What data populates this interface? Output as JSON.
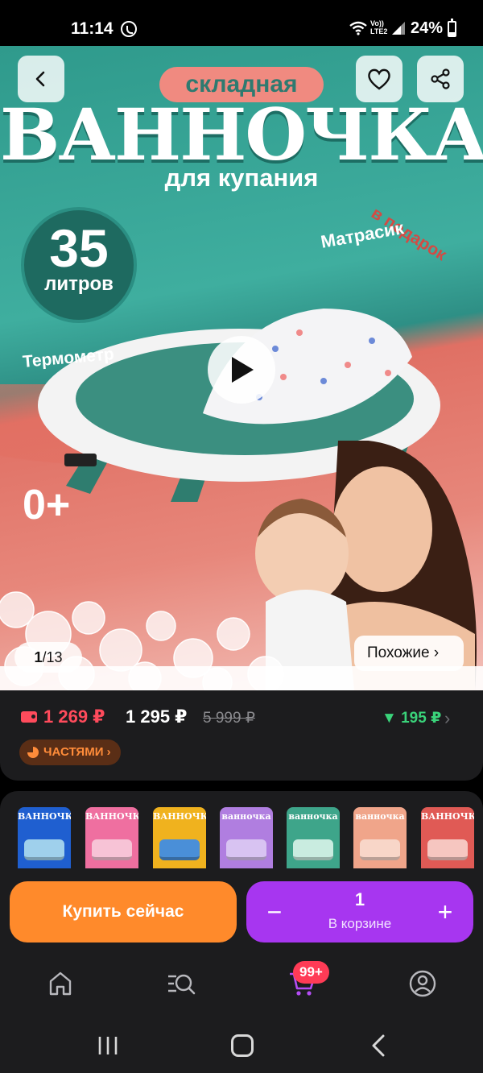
{
  "status_bar": {
    "time": "11:14",
    "network_label": "Vo)) LTE2",
    "battery": "24%"
  },
  "hero": {
    "pill_text": "складная",
    "title": "ВАННОЧКА",
    "subtitle": "для купания",
    "liters_number": "35",
    "liters_unit": "литров",
    "gift_label": "в подарок",
    "mattress_label": "Матрасик",
    "thermometer_label": "Термометр",
    "age_label": "0+",
    "counter_current": "1",
    "counter_total": "/13",
    "similar_label": "Похожие ›",
    "colors": {
      "teal": "#2f9a8c",
      "coral": "#e07064"
    }
  },
  "price": {
    "card_price": "1 269 ₽",
    "price": "1 295 ₽",
    "old_price": "5 999 ₽",
    "cashback": "▼ 195 ₽",
    "cashback_chevron": "›",
    "installments_label": "ЧАСТЯМИ ›"
  },
  "variants": [
    {
      "title": "ВАННОЧКА",
      "color": "#1f5fd0",
      "tub": "#9fd0ec"
    },
    {
      "title": "ВАННОЧКА",
      "color": "#ef6fa0",
      "tub": "#f7c3d6"
    },
    {
      "title": "ВАННОЧКА",
      "color": "#f0b21e",
      "tub": "#4a8fd8"
    },
    {
      "title": "ванночка",
      "color": "#b07ee0",
      "tub": "#d8c3f2"
    },
    {
      "title": "ванночка",
      "color": "#3ea58a",
      "tub": "#c9ece0"
    },
    {
      "title": "ванночка",
      "color": "#f0a58a",
      "tub": "#f8d6c8"
    },
    {
      "title": "ВАННОЧКА",
      "color": "#e05a55",
      "tub": "#f6c6c0"
    }
  ],
  "actions": {
    "buy_now": "Купить сейчас",
    "minus": "−",
    "quantity": "1",
    "in_cart": "В корзине",
    "plus": "+"
  },
  "bottom_nav": {
    "cart_badge": "99+",
    "icons": [
      "home-icon",
      "catalog-search-icon",
      "cart-icon",
      "profile-icon"
    ]
  },
  "system_nav": {
    "icons": [
      "recent-apps-icon",
      "home-icon",
      "back-icon"
    ]
  }
}
